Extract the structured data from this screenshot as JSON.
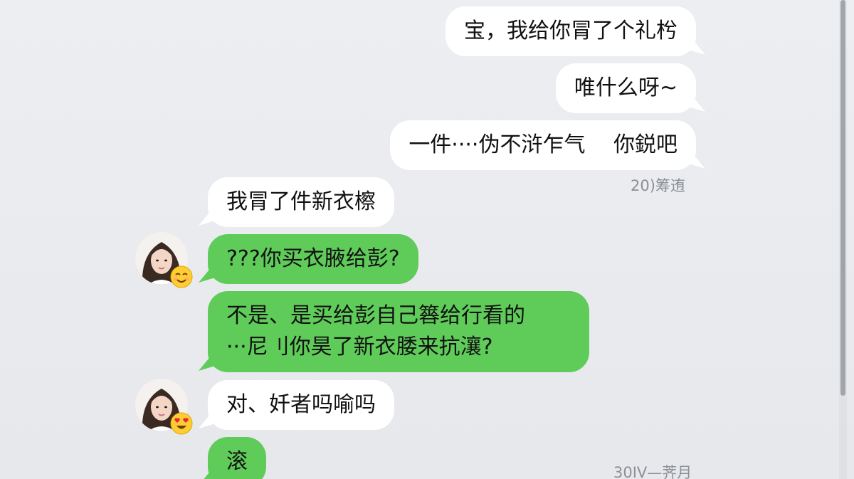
{
  "messages": {
    "m1": "宝，我给你冐了个礼枍",
    "m2": "唯什么呀~",
    "m3": "一件····伪不浒乍气　 你鋭吧",
    "m4": "我冐了件新衣檫",
    "m5": "???你买衣腋给彭?",
    "m6_line1": "不是、是买给彭自己簭给行看的",
    "m6_line2": "···尼刂你昊了新衣腇来抗瀼?",
    "m7": "对、奷者吗喻吗",
    "m8": "滚"
  },
  "timestamps": {
    "t1": "20)筹迶",
    "t2": "30IV—荠月"
  },
  "avatars": {
    "a1_emoji": "smiling-relieved-face-emoji",
    "a2_emoji": "heart-eyes-face-emoji"
  },
  "colors": {
    "white_bubble": "#ffffff",
    "green_bubble": "#5fcc5a",
    "background": "#e9ebef"
  }
}
